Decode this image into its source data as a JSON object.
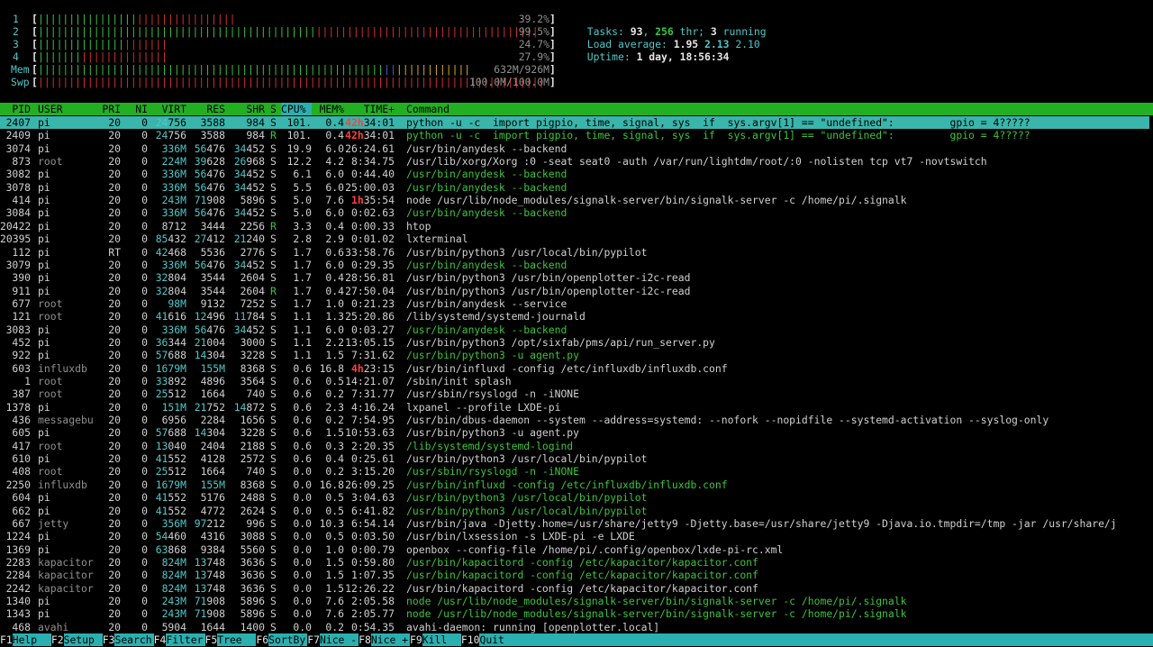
{
  "meters": {
    "cpus": [
      {
        "label": "1",
        "value": "39.2%",
        "green": 16,
        "red": 16
      },
      {
        "label": "2",
        "value": "99.5%",
        "green": 45,
        "red": 36
      },
      {
        "label": "3",
        "value": "24.7%",
        "green": 14,
        "red": 7
      },
      {
        "label": "4",
        "value": "27.9%",
        "green": 7,
        "red": 14
      }
    ],
    "mem": {
      "label": "Mem",
      "value": "632M/926M",
      "green": 56,
      "blue": 2,
      "orange": 12
    },
    "swp": {
      "label": "Swp",
      "value": "100.0M/100.0M",
      "red": 82
    }
  },
  "summary": {
    "tasks_label": "Tasks: ",
    "tasks": "93",
    "sep1": ", ",
    "threads": "256",
    "thr_label": " thr; ",
    "running": "3",
    "running_label": " running",
    "load_label": "Load average: ",
    "load1": "1.95",
    "load5": "2.13",
    "load15": "2.10",
    "uptime_label": "Uptime: ",
    "uptime": "1 day, 18:56:34"
  },
  "columns": {
    "pid": "PID",
    "user": "USER",
    "pri": "PRI",
    "ni": "NI",
    "virt": "VIRT",
    "res": "RES",
    "shr": "SHR",
    "s": "S",
    "cpu": "CPU%",
    "mem": "MEM%",
    "time": "TIME+",
    "cmd": "Command"
  },
  "processes": [
    {
      "pid": "2407",
      "user": "pi",
      "pri": "20",
      "ni": "0",
      "virt": "24756",
      "res": "3588",
      "shr": "984",
      "s": "S",
      "cpu": "101.",
      "mem": "0.4",
      "time_a": "42h",
      "time_b": "34:01",
      "cmd": "python -u -c  import pigpio, time, signal, sys  if  sys.argv[1] == \"undefined\":         gpio = 4?????"
    },
    {
      "pid": "2409",
      "user": "pi",
      "pri": "20",
      "ni": "0",
      "virt": "24756",
      "res": "3588",
      "shr": "984",
      "s": "R",
      "cpu": "101.",
      "mem": "0.4",
      "time_a": "42h",
      "time_b": "34:01",
      "cmd": "python -u -c  import pigpio, time, signal, sys  if  sys.argv[1] == \"undefined\":         gpio = 4?????"
    },
    {
      "pid": "3074",
      "user": "pi",
      "pri": "20",
      "ni": "0",
      "virt": "336M",
      "res": "56476",
      "shr": "34452",
      "s": "S",
      "cpu": "19.9",
      "mem": "6.0",
      "time_a": "",
      "time_b": "26:24.61",
      "cmd": "/usr/bin/anydesk --backend"
    },
    {
      "pid": "873",
      "user": "root",
      "pri": "20",
      "ni": "0",
      "virt": "224M",
      "res": "39628",
      "shr": "26968",
      "s": "S",
      "cpu": "12.2",
      "mem": "4.2",
      "time_a": "",
      "time_b": "8:34.75",
      "cmd": "/usr/lib/xorg/Xorg :0 -seat seat0 -auth /var/run/lightdm/root/:0 -nolisten tcp vt7 -novtswitch"
    },
    {
      "pid": "3082",
      "user": "pi",
      "pri": "20",
      "ni": "0",
      "virt": "336M",
      "res": "56476",
      "shr": "34452",
      "s": "S",
      "cpu": "6.1",
      "mem": "6.0",
      "time_a": "",
      "time_b": "0:44.40",
      "cmd": "/usr/bin/anydesk --backend"
    },
    {
      "pid": "3078",
      "user": "pi",
      "pri": "20",
      "ni": "0",
      "virt": "336M",
      "res": "56476",
      "shr": "34452",
      "s": "S",
      "cpu": "5.5",
      "mem": "6.0",
      "time_a": "",
      "time_b": "25:00.03",
      "cmd": "/usr/bin/anydesk --backend"
    },
    {
      "pid": "414",
      "user": "pi",
      "pri": "20",
      "ni": "0",
      "virt": "243M",
      "res": "71908",
      "shr": "5896",
      "s": "S",
      "cpu": "5.0",
      "mem": "7.6",
      "time_a": "1h",
      "time_b": "35:54",
      "cmd": "node /usr/lib/node_modules/signalk-server/bin/signalk-server -c /home/pi/.signalk"
    },
    {
      "pid": "3084",
      "user": "pi",
      "pri": "20",
      "ni": "0",
      "virt": "336M",
      "res": "56476",
      "shr": "34452",
      "s": "S",
      "cpu": "5.0",
      "mem": "6.0",
      "time_a": "",
      "time_b": "0:02.63",
      "cmd": "/usr/bin/anydesk --backend"
    },
    {
      "pid": "20422",
      "user": "pi",
      "pri": "20",
      "ni": "0",
      "virt": "8712",
      "res": "3444",
      "shr": "2256",
      "s": "R",
      "cpu": "3.3",
      "mem": "0.4",
      "time_a": "",
      "time_b": "0:00.33",
      "cmd": "htop"
    },
    {
      "pid": "20395",
      "user": "pi",
      "pri": "20",
      "ni": "0",
      "virt": "85432",
      "res": "27412",
      "shr": "21240",
      "s": "S",
      "cpu": "2.8",
      "mem": "2.9",
      "time_a": "",
      "time_b": "0:01.02",
      "cmd": "lxterminal"
    },
    {
      "pid": "112",
      "user": "pi",
      "pri": "RT",
      "ni": "0",
      "virt": "42468",
      "res": "5536",
      "shr": "2776",
      "s": "S",
      "cpu": "1.7",
      "mem": "0.6",
      "time_a": "",
      "time_b": "33:58.76",
      "cmd": "/usr/bin/python3 /usr/local/bin/pypilot"
    },
    {
      "pid": "3079",
      "user": "pi",
      "pri": "20",
      "ni": "0",
      "virt": "336M",
      "res": "56476",
      "shr": "34452",
      "s": "S",
      "cpu": "1.7",
      "mem": "6.0",
      "time_a": "",
      "time_b": "0:29.35",
      "cmd": "/usr/bin/anydesk --backend"
    },
    {
      "pid": "390",
      "user": "pi",
      "pri": "20",
      "ni": "0",
      "virt": "32804",
      "res": "3544",
      "shr": "2604",
      "s": "S",
      "cpu": "1.7",
      "mem": "0.4",
      "time_a": "",
      "time_b": "28:56.81",
      "cmd": "/usr/bin/python3 /usr/bin/openplotter-i2c-read"
    },
    {
      "pid": "911",
      "user": "pi",
      "pri": "20",
      "ni": "0",
      "virt": "32804",
      "res": "3544",
      "shr": "2604",
      "s": "R",
      "cpu": "1.7",
      "mem": "0.4",
      "time_a": "",
      "time_b": "27:50.04",
      "cmd": "/usr/bin/python3 /usr/bin/openplotter-i2c-read"
    },
    {
      "pid": "677",
      "user": "root",
      "pri": "20",
      "ni": "0",
      "virt": "98M",
      "res": "9132",
      "shr": "7252",
      "s": "S",
      "cpu": "1.7",
      "mem": "1.0",
      "time_a": "",
      "time_b": "0:21.23",
      "cmd": "/usr/bin/anydesk --service"
    },
    {
      "pid": "121",
      "user": "root",
      "pri": "20",
      "ni": "0",
      "virt": "41616",
      "res": "12496",
      "shr": "11784",
      "s": "S",
      "cpu": "1.1",
      "mem": "1.3",
      "time_a": "",
      "time_b": "25:20.86",
      "cmd": "/lib/systemd/systemd-journald"
    },
    {
      "pid": "3083",
      "user": "pi",
      "pri": "20",
      "ni": "0",
      "virt": "336M",
      "res": "56476",
      "shr": "34452",
      "s": "S",
      "cpu": "1.1",
      "mem": "6.0",
      "time_a": "",
      "time_b": "0:03.27",
      "cmd": "/usr/bin/anydesk --backend"
    },
    {
      "pid": "452",
      "user": "pi",
      "pri": "20",
      "ni": "0",
      "virt": "36344",
      "res": "21004",
      "shr": "3000",
      "s": "S",
      "cpu": "1.1",
      "mem": "2.2",
      "time_a": "",
      "time_b": "13:05.15",
      "cmd": "/usr/bin/python3 /opt/sixfab/pms/api/run_server.py"
    },
    {
      "pid": "922",
      "user": "pi",
      "pri": "20",
      "ni": "0",
      "virt": "57688",
      "res": "14304",
      "shr": "3228",
      "s": "S",
      "cpu": "1.1",
      "mem": "1.5",
      "time_a": "",
      "time_b": "7:31.62",
      "cmd": "/usr/bin/python3 -u agent.py"
    },
    {
      "pid": "603",
      "user": "influxdb",
      "pri": "20",
      "ni": "0",
      "virt": "1679M",
      "res": "155M",
      "shr": "8368",
      "s": "S",
      "cpu": "0.6",
      "mem": "16.8",
      "time_a": "4h",
      "time_b": "23:15",
      "cmd": "/usr/bin/influxd -config /etc/influxdb/influxdb.conf"
    },
    {
      "pid": "1",
      "user": "root",
      "pri": "20",
      "ni": "0",
      "virt": "33892",
      "res": "4896",
      "shr": "3564",
      "s": "S",
      "cpu": "0.6",
      "mem": "0.5",
      "time_a": "",
      "time_b": "14:21.07",
      "cmd": "/sbin/init splash"
    },
    {
      "pid": "387",
      "user": "root",
      "pri": "20",
      "ni": "0",
      "virt": "25512",
      "res": "1664",
      "shr": "740",
      "s": "S",
      "cpu": "0.6",
      "mem": "0.2",
      "time_a": "",
      "time_b": "7:31.77",
      "cmd": "/usr/sbin/rsyslogd -n -iNONE"
    },
    {
      "pid": "1378",
      "user": "pi",
      "pri": "20",
      "ni": "0",
      "virt": "151M",
      "res": "21752",
      "shr": "14872",
      "s": "S",
      "cpu": "0.6",
      "mem": "2.3",
      "time_a": "",
      "time_b": "4:16.24",
      "cmd": "lxpanel --profile LXDE-pi"
    },
    {
      "pid": "436",
      "user": "messagebu",
      "pri": "20",
      "ni": "0",
      "virt": "6956",
      "res": "2284",
      "shr": "1656",
      "s": "S",
      "cpu": "0.6",
      "mem": "0.2",
      "time_a": "",
      "time_b": "7:54.95",
      "cmd": "/usr/bin/dbus-daemon --system --address=systemd: --nofork --nopidfile --systemd-activation --syslog-only"
    },
    {
      "pid": "605",
      "user": "pi",
      "pri": "20",
      "ni": "0",
      "virt": "57688",
      "res": "14304",
      "shr": "3228",
      "s": "S",
      "cpu": "0.6",
      "mem": "1.5",
      "time_a": "",
      "time_b": "10:53.63",
      "cmd": "/usr/bin/python3 -u agent.py"
    },
    {
      "pid": "417",
      "user": "root",
      "pri": "20",
      "ni": "0",
      "virt": "13040",
      "res": "2404",
      "shr": "2188",
      "s": "S",
      "cpu": "0.6",
      "mem": "0.3",
      "time_a": "",
      "time_b": "2:20.35",
      "cmd": "/lib/systemd/systemd-logind"
    },
    {
      "pid": "610",
      "user": "pi",
      "pri": "20",
      "ni": "0",
      "virt": "41552",
      "res": "4128",
      "shr": "2572",
      "s": "S",
      "cpu": "0.6",
      "mem": "0.4",
      "time_a": "",
      "time_b": "0:25.61",
      "cmd": "/usr/bin/python3 /usr/local/bin/pypilot"
    },
    {
      "pid": "408",
      "user": "root",
      "pri": "20",
      "ni": "0",
      "virt": "25512",
      "res": "1664",
      "shr": "740",
      "s": "S",
      "cpu": "0.0",
      "mem": "0.2",
      "time_a": "",
      "time_b": "3:15.20",
      "cmd": "/usr/sbin/rsyslogd -n -iNONE"
    },
    {
      "pid": "2250",
      "user": "influxdb",
      "pri": "20",
      "ni": "0",
      "virt": "1679M",
      "res": "155M",
      "shr": "8368",
      "s": "S",
      "cpu": "0.0",
      "mem": "16.8",
      "time_a": "",
      "time_b": "26:09.25",
      "cmd": "/usr/bin/influxd -config /etc/influxdb/influxdb.conf"
    },
    {
      "pid": "604",
      "user": "pi",
      "pri": "20",
      "ni": "0",
      "virt": "41552",
      "res": "5176",
      "shr": "2488",
      "s": "S",
      "cpu": "0.0",
      "mem": "0.5",
      "time_a": "",
      "time_b": "3:04.63",
      "cmd": "/usr/bin/python3 /usr/local/bin/pypilot"
    },
    {
      "pid": "662",
      "user": "pi",
      "pri": "20",
      "ni": "0",
      "virt": "41552",
      "res": "4772",
      "shr": "2624",
      "s": "S",
      "cpu": "0.0",
      "mem": "0.5",
      "time_a": "",
      "time_b": "6:41.82",
      "cmd": "/usr/bin/python3 /usr/local/bin/pypilot"
    },
    {
      "pid": "667",
      "user": "jetty",
      "pri": "20",
      "ni": "0",
      "virt": "356M",
      "res": "97212",
      "shr": "996",
      "s": "S",
      "cpu": "0.0",
      "mem": "10.3",
      "time_a": "",
      "time_b": "6:54.14",
      "cmd": "/usr/bin/java -Djetty.home=/usr/share/jetty9 -Djetty.base=/usr/share/jetty9 -Djava.io.tmpdir=/tmp -jar /usr/share/j"
    },
    {
      "pid": "1224",
      "user": "pi",
      "pri": "20",
      "ni": "0",
      "virt": "54460",
      "res": "4316",
      "shr": "3088",
      "s": "S",
      "cpu": "0.0",
      "mem": "0.5",
      "time_a": "",
      "time_b": "0:03.50",
      "cmd": "/usr/bin/lxsession -s LXDE-pi -e LXDE"
    },
    {
      "pid": "1369",
      "user": "pi",
      "pri": "20",
      "ni": "0",
      "virt": "63868",
      "res": "9384",
      "shr": "5560",
      "s": "S",
      "cpu": "0.0",
      "mem": "1.0",
      "time_a": "",
      "time_b": "0:00.79",
      "cmd": "openbox --config-file /home/pi/.config/openbox/lxde-pi-rc.xml"
    },
    {
      "pid": "2283",
      "user": "kapacitor",
      "pri": "20",
      "ni": "0",
      "virt": "824M",
      "res": "13748",
      "shr": "3636",
      "s": "S",
      "cpu": "0.0",
      "mem": "1.5",
      "time_a": "",
      "time_b": "0:59.80",
      "cmd": "/usr/bin/kapacitord -config /etc/kapacitor/kapacitor.conf"
    },
    {
      "pid": "2284",
      "user": "kapacitor",
      "pri": "20",
      "ni": "0",
      "virt": "824M",
      "res": "13748",
      "shr": "3636",
      "s": "S",
      "cpu": "0.0",
      "mem": "1.5",
      "time_a": "",
      "time_b": "1:07.35",
      "cmd": "/usr/bin/kapacitord -config /etc/kapacitor/kapacitor.conf"
    },
    {
      "pid": "2242",
      "user": "kapacitor",
      "pri": "20",
      "ni": "0",
      "virt": "824M",
      "res": "13748",
      "shr": "3636",
      "s": "S",
      "cpu": "0.0",
      "mem": "1.5",
      "time_a": "",
      "time_b": "12:26.22",
      "cmd": "/usr/bin/kapacitord -config /etc/kapacitor/kapacitor.conf"
    },
    {
      "pid": "1340",
      "user": "pi",
      "pri": "20",
      "ni": "0",
      "virt": "243M",
      "res": "71908",
      "shr": "5896",
      "s": "S",
      "cpu": "0.0",
      "mem": "7.6",
      "time_a": "",
      "time_b": "2:05.58",
      "cmd": "node /usr/lib/node_modules/signalk-server/bin/signalk-server -c /home/pi/.signalk"
    },
    {
      "pid": "1343",
      "user": "pi",
      "pri": "20",
      "ni": "0",
      "virt": "243M",
      "res": "71908",
      "shr": "5896",
      "s": "S",
      "cpu": "0.0",
      "mem": "7.6",
      "time_a": "",
      "time_b": "2:05.77",
      "cmd": "node /usr/lib/node_modules/signalk-server/bin/signalk-server -c /home/pi/.signalk"
    },
    {
      "pid": "468",
      "user": "avahi",
      "pri": "20",
      "ni": "0",
      "virt": "5904",
      "res": "1644",
      "shr": "1400",
      "s": "S",
      "cpu": "0.0",
      "mem": "0.2",
      "time_a": "",
      "time_b": "0:54.35",
      "cmd": "avahi-daemon: running [openplotter.local]"
    }
  ],
  "thread_rows": [
    1,
    4,
    5,
    7,
    11,
    16,
    18,
    25,
    27,
    28,
    29,
    30,
    34,
    35,
    37,
    38
  ],
  "big_virt": [
    "336M",
    "224M",
    "243M",
    "98M",
    "1679M",
    "151M",
    "356M",
    "824M"
  ],
  "footer": [
    {
      "key": "F1",
      "label": "Help  "
    },
    {
      "key": "F2",
      "label": "Setup "
    },
    {
      "key": "F3",
      "label": "Search"
    },
    {
      "key": "F4",
      "label": "Filter"
    },
    {
      "key": "F5",
      "label": "Tree  "
    },
    {
      "key": "F6",
      "label": "SortBy"
    },
    {
      "key": "F7",
      "label": "Nice -"
    },
    {
      "key": "F8",
      "label": "Nice +"
    },
    {
      "key": "F9",
      "label": "Kill  "
    },
    {
      "key": "F10",
      "label": "Quit"
    }
  ],
  "colors": {
    "header_bg": "#22b022",
    "selected_bg": "#39b5ac",
    "footer_bg": "#2ab0b0",
    "thread_green": "#3cc43c"
  }
}
